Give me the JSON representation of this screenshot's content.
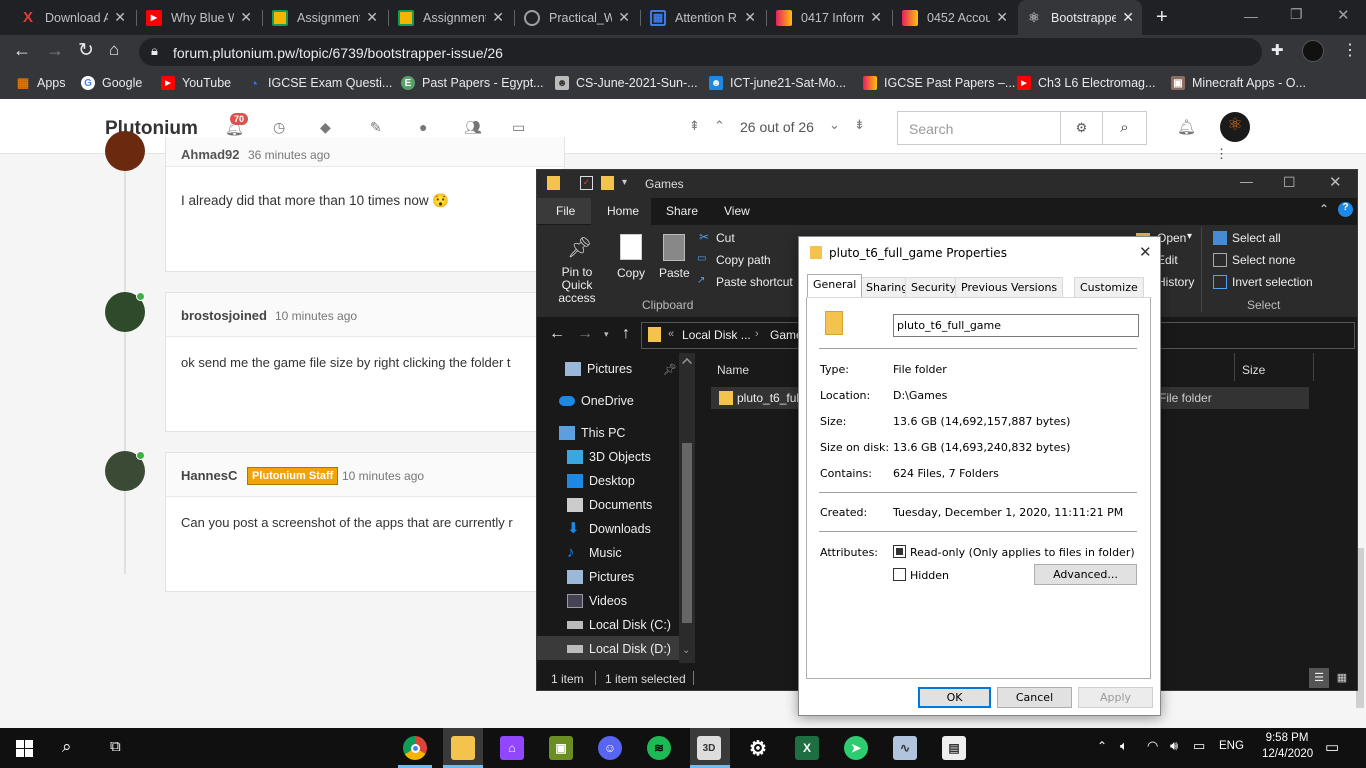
{
  "browser": {
    "tabs": [
      {
        "label": "Download A",
        "icon": "x-logo-icon",
        "color": "#e53935"
      },
      {
        "label": "Why Blue W",
        "icon": "youtube-icon",
        "color": "#ff0000"
      },
      {
        "label": "Assignment",
        "icon": "classroom-icon",
        "color": "#f4b400"
      },
      {
        "label": "Assignment",
        "icon": "classroom-icon",
        "color": "#f4b400"
      },
      {
        "label": "Practical_W",
        "icon": "globe-icon",
        "color": "#9aa0a6"
      },
      {
        "label": "Attention R",
        "icon": "table-icon",
        "color": "#3d7ae5"
      },
      {
        "label": "0417 Inform",
        "icon": "papacambridge-icon",
        "color": "#e91e63"
      },
      {
        "label": "0452 Accou",
        "icon": "papacambridge-icon",
        "color": "#e91e63"
      },
      {
        "label": "Bootstrappe",
        "icon": "plutonium-icon",
        "color": "#9aa0a6"
      }
    ],
    "url": "forum.plutonium.pw/topic/6739/bootstrapper-issue/26",
    "bookmarks": [
      {
        "label": "Apps",
        "icon": "apps-grid-icon",
        "color": "#e37400"
      },
      {
        "label": "Google",
        "icon": "google-icon",
        "color": "#4285f4"
      },
      {
        "label": "YouTube",
        "icon": "youtube-icon",
        "color": "#ff0000"
      },
      {
        "label": "IGCSE Exam Questi...",
        "icon": "loader-icon",
        "color": "#1e88e5"
      },
      {
        "label": "Past Papers - Egypt...",
        "icon": "egypt-icon",
        "color": "#5aa06a"
      },
      {
        "label": "CS-June-2021-Sun-...",
        "icon": "contact-icon",
        "color": "#888"
      },
      {
        "label": "ICT-june21-Sat-Mo...",
        "icon": "contact-icon",
        "color": "#1e88e5"
      },
      {
        "label": "IGCSE Past Papers –...",
        "icon": "papacambridge-icon",
        "color": "#e91e63"
      },
      {
        "label": "Ch3 L6 Electromag...",
        "icon": "youtube-icon",
        "color": "#ff0000"
      },
      {
        "label": "Minecraft Apps - O...",
        "icon": "minecraft-icon",
        "color": "#8d6e63"
      }
    ]
  },
  "site": {
    "brand": "Plutonium",
    "notification_count": "70",
    "pagination": "26 out of 26",
    "search_placeholder": "Search"
  },
  "posts": [
    {
      "author": "Ahmad92",
      "time": "36 minutes ago",
      "body": "I already did that more than 10 times now 😯",
      "avatar_color": "#6b2a10"
    },
    {
      "author": "brostosjoined",
      "time": "10 minutes ago",
      "body": "ok send me the game file size by right clicking the folder t",
      "avatar_color": "#2e4a2b"
    },
    {
      "author": "HannesC",
      "badge": "Plutonium Staff",
      "time": "10 minutes ago",
      "body": "Can you post a screenshot of the apps that are currently r",
      "avatar_color": "#3a4a35"
    }
  ],
  "explorer": {
    "title": "Games",
    "ribbon_tabs": [
      "File",
      "Home",
      "Share",
      "View"
    ],
    "clipboard": {
      "pin": "Pin to Quick access",
      "copy": "Copy",
      "paste": "Paste",
      "cut": "Cut",
      "copy_path": "Copy path",
      "paste_shortcut": "Paste shortcut",
      "group": "Clipboard"
    },
    "open_group": {
      "open": "Open",
      "edit": "Edit",
      "history": "History"
    },
    "select": {
      "all": "Select all",
      "none": "Select none",
      "invert": "Invert selection",
      "group": "Select"
    },
    "breadcrumb": [
      "Local Disk ...",
      "Games"
    ],
    "columns": {
      "name": "Name",
      "size": "Size"
    },
    "file_row": {
      "name": "pluto_t6_full_game",
      "type": "File folder"
    },
    "nav": [
      "Pictures",
      "OneDrive",
      "This PC",
      "3D Objects",
      "Desktop",
      "Documents",
      "Downloads",
      "Music",
      "Pictures",
      "Videos",
      "Local Disk (C:)",
      "Local Disk (D:)"
    ],
    "status": {
      "count": "1 item",
      "selected": "1 item selected"
    }
  },
  "dialog": {
    "title": "pluto_t6_full_game Properties",
    "tabs": [
      "General",
      "Sharing",
      "Security",
      "Previous Versions",
      "Customize"
    ],
    "name": "pluto_t6_full_game",
    "type_label": "Type:",
    "type": "File folder",
    "location_label": "Location:",
    "location": "D:\\Games",
    "size_label": "Size:",
    "size": "13.6 GB (14,692,157,887 bytes)",
    "size_on_disk_label": "Size on disk:",
    "size_on_disk": "13.6 GB (14,693,240,832 bytes)",
    "contains_label": "Contains:",
    "contains": "624 Files, 7 Folders",
    "created_label": "Created:",
    "created": "Tuesday, December 1, 2020, 11:11:21 PM",
    "attributes_label": "Attributes:",
    "readonly": "Read-only (Only applies to files in folder)",
    "hidden": "Hidden",
    "advanced": "Advanced...",
    "ok": "OK",
    "cancel": "Cancel",
    "apply": "Apply"
  },
  "taskbar": {
    "time": "9:58 PM",
    "date": "12/4/2020",
    "lang": "ENG"
  }
}
